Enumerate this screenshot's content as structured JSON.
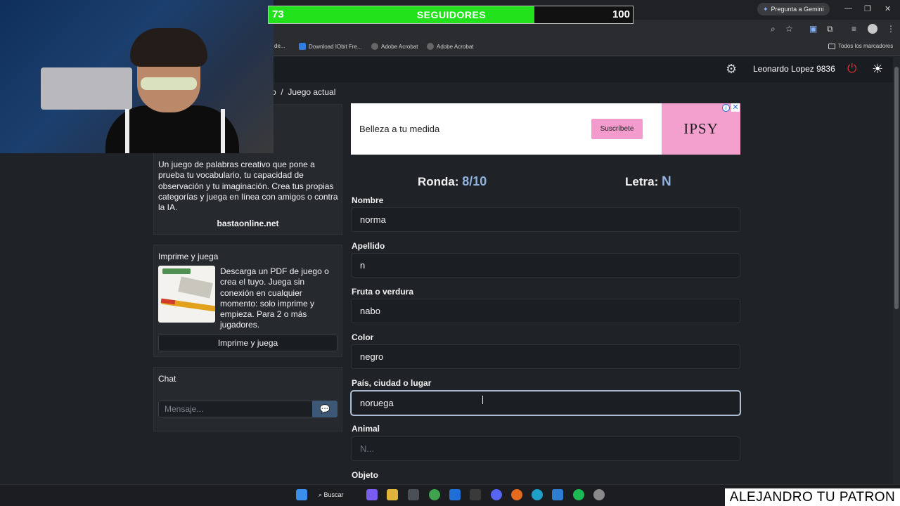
{
  "browser": {
    "gemini_label": "Pregunta a Gemini",
    "bookmarks": [
      "de...",
      "Download IObit Fre...",
      "Adobe Acrobat",
      "Adobe Acrobat"
    ],
    "all_bookmarks_label": "Todos los marcadores"
  },
  "overlay": {
    "followers_current": "73",
    "followers_label": "SEGUIDORES",
    "followers_goal": "100",
    "progress": 0.73,
    "fill_color": "#22e21b"
  },
  "nav": {
    "user_name": "Leonardo Lopez 9836",
    "breadcrumb": "o  /  Juego actual"
  },
  "sidebar": {
    "description": "Un juego de palabras creativo que pone a prueba tu vocabulario, tu capacidad de observación y tu imaginación. Crea tus propias categorías y juega en línea con amigos o contra la IA.",
    "site": "bastaonline.net",
    "print": {
      "title": "Imprime y juega",
      "text": "Descarga un PDF de juego o crea el tuyo. Juega sin conexión en cualquier momento: solo imprime y empieza. Para 2 o más jugadores.",
      "button": "Imprime y juega"
    },
    "chat": {
      "title": "Chat",
      "placeholder": "Mensaje..."
    }
  },
  "ad": {
    "text": "Belleza a tu medida",
    "button": "Suscríbete",
    "brand": "IPSY"
  },
  "game": {
    "round_label": "Ronda:",
    "round_value": "8/10",
    "letter_label": "Letra:",
    "letter_value": "N",
    "fields": [
      {
        "label": "Nombre",
        "value": "norma",
        "placeholder": ""
      },
      {
        "label": "Apellido",
        "value": "n",
        "placeholder": ""
      },
      {
        "label": "Fruta o verdura",
        "value": "nabo",
        "placeholder": ""
      },
      {
        "label": "Color",
        "value": "negro",
        "placeholder": ""
      },
      {
        "label": "País, ciudad o lugar",
        "value": "noruega",
        "placeholder": ""
      },
      {
        "label": "Animal",
        "value": "",
        "placeholder": "N..."
      },
      {
        "label": "Objeto",
        "value": "",
        "placeholder": ""
      }
    ]
  },
  "taskbar": {
    "search_label": "Buscar"
  },
  "watermark": "ALEJANDRO TU PATRON",
  "colors": {
    "accent": "#8fb3e0",
    "ad_pink": "#f39bcd",
    "power_red": "#e03131"
  }
}
